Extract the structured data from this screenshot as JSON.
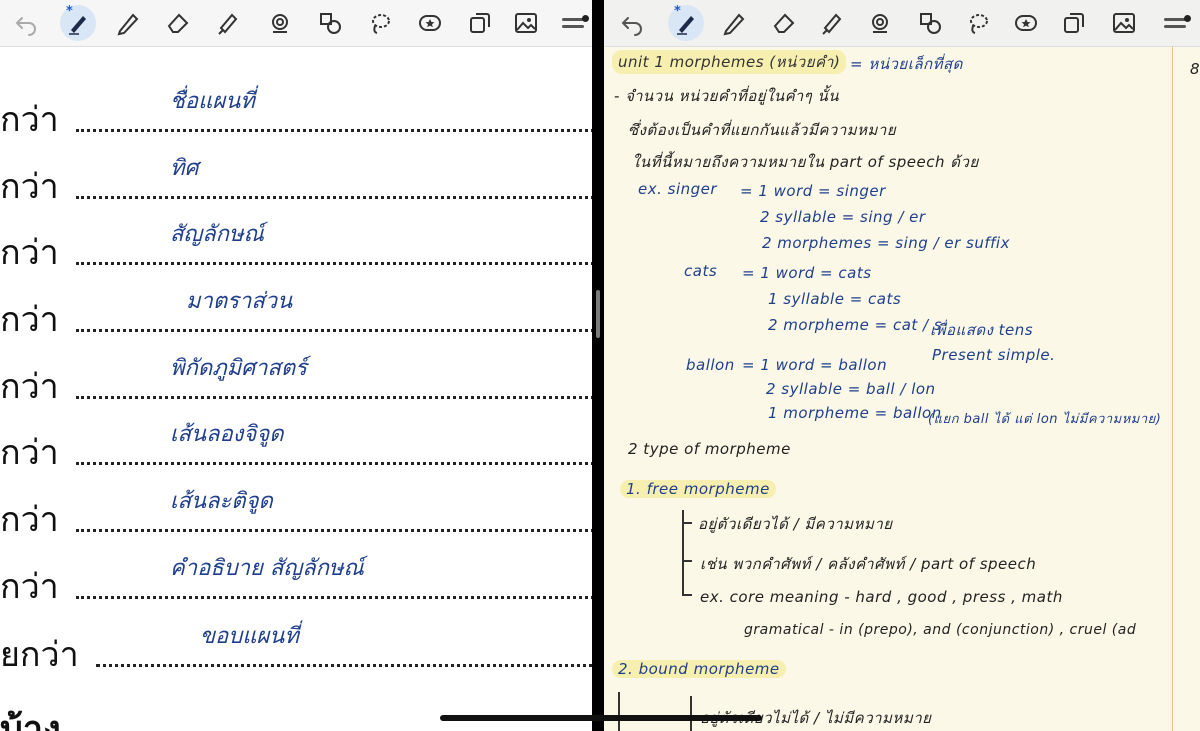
{
  "toolbar": {
    "tools": [
      {
        "name": "undo-icon"
      },
      {
        "name": "pen-icon"
      },
      {
        "name": "pencil-icon"
      },
      {
        "name": "eraser-icon"
      },
      {
        "name": "highlighter-icon"
      },
      {
        "name": "lasso-stamp-icon"
      },
      {
        "name": "shapes-icon"
      },
      {
        "name": "lasso-icon"
      },
      {
        "name": "sticker-icon"
      },
      {
        "name": "copy-icon"
      },
      {
        "name": "image-icon"
      },
      {
        "name": "menu-icon"
      }
    ]
  },
  "worksheet": {
    "rows": [
      {
        "prefix": "กว่า",
        "answer": "ชื่อแผนที่"
      },
      {
        "prefix": "กว่า",
        "answer": "ทิศ"
      },
      {
        "prefix": "กว่า",
        "answer": "สัญลักษณ์"
      },
      {
        "prefix": "กว่า",
        "answer": "มาตราส่วน"
      },
      {
        "prefix": "กว่า",
        "answer": "พิกัดภูมิศาสตร์"
      },
      {
        "prefix": "กว่า",
        "answer": "เส้นลองจิจูด"
      },
      {
        "prefix": "กว่า",
        "answer": "เส้นละติจูด"
      },
      {
        "prefix": "กว่า",
        "answer": "คำอธิบาย สัญลักษณ์"
      },
      {
        "prefix": "ยกว่า",
        "answer": "ขอบแผนที่"
      }
    ],
    "footer": "บ้าง"
  },
  "notes": {
    "title": "unit 1 morphemes (หน่วยคำ)",
    "title_note": "= หน่วยเล็กที่สุด",
    "def1": "- จำนวน หน่วยคำที่อยู่ในคำๆ นั้น",
    "def2": "ซึ่งต้องเป็นคำที่แยกกันแล้วมีความหมาย",
    "def3": "ในที่นี้หมายถึงความหมายใน part of speech ด้วย",
    "ex_label": "ex. singer",
    "singer_1": "= 1 word = singer",
    "singer_2": "2 syllable = sing / er",
    "singer_3": "2 morphemes = sing / er suffix",
    "cats_label": "cats",
    "cats_1": "= 1 word = cats",
    "cats_2": "1 syllable = cats",
    "cats_3": "2 morpheme = cat / s",
    "cats_3b": "เพื่อแสดง tens",
    "cats_4": "Present simple.",
    "ballon_label": "ballon",
    "ballon_1": "= 1 word = ballon",
    "ballon_2": "2 syllable = ball / lon",
    "ballon_3": "1 morpheme = ballon",
    "ballon_3b": "(แยก ball ได้ แต่ lon ไม่มีความหมาย)",
    "types": "2 type of morpheme",
    "free_head": "1. free morpheme",
    "free_1": "อยู่ตัวเดียวได้ / มีความหมาย",
    "free_2": "เช่น พวกคำศัพท์ / คลังคำศัพท์ / part of speech",
    "free_3": "ex. core meaning - hard , good , press , math",
    "free_4": "gramatical - in (prepo), and (conjunction) , cruel (ad",
    "bound_head": "2. bound morpheme",
    "bound_1": "อยู่ตัวเดียวไม่ได้ / ไม่มีความหมาย",
    "margin_8": "8"
  },
  "colors": {
    "ink_blue": "#1f3f8c",
    "highlight": "#f6efb0",
    "paper": "#fbf8e7"
  }
}
